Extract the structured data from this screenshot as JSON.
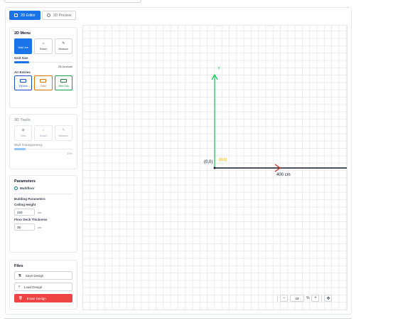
{
  "tabs": [
    {
      "label": "2D Editor",
      "icon": "square-icon",
      "active": true
    },
    {
      "label": "3D Preview",
      "icon": "cube-icon",
      "active": false
    }
  ],
  "menu2d": {
    "title": "2D Menu",
    "tools": [
      {
        "label": "Wall Line",
        "icon": "pencil-icon",
        "glyph": "",
        "active": true
      },
      {
        "label": "Eraser",
        "icon": "eraser-icon",
        "glyph": "⌂",
        "active": false
      },
      {
        "label": "Measure",
        "icon": "ruler-icon",
        "glyph": "✎",
        "active": false
      }
    ],
    "grid_size_label": "Grid Size",
    "grid_size_value": "25.0cm/cell",
    "grid_size_fraction": 0.25,
    "air_entries_label": "Air Entries",
    "air_entries": [
      {
        "label": "Window",
        "color": "#1d4ed8"
      },
      {
        "label": "Door",
        "color": "#d97706"
      },
      {
        "label": "Vent Grid",
        "color": "#16a34a"
      }
    ]
  },
  "tools3d": {
    "title": "3D Tools",
    "tools": [
      {
        "label": "View",
        "icon": "eye-icon",
        "glyph": "◉"
      },
      {
        "label": "Eraser",
        "icon": "eraser-icon",
        "glyph": "⌂"
      },
      {
        "label": "Measure",
        "icon": "ruler-icon",
        "glyph": "✎"
      }
    ],
    "transparency_label": "Wall Transparency",
    "transparency_value": "20%",
    "transparency_fraction": 0.2
  },
  "parameters": {
    "title": "Parameters",
    "multifloor_label": "Multifloor",
    "building_label": "Building Parameters",
    "ceiling_label": "Ceiling Height",
    "ceiling_value": "220",
    "ceiling_unit": "cm",
    "deck_label": "Floor Deck Thickness",
    "deck_value": "35",
    "deck_unit": "cm"
  },
  "files": {
    "title": "Files",
    "save_label": "Save Design",
    "load_label": "Load Design",
    "erase_label": "Erase Design"
  },
  "canvas": {
    "y_axis_label": "Y",
    "origin_label": "(0,0)",
    "origin_label2": "(0,0)",
    "x_measure_label": "400 cm",
    "x_axis_color": "#dc2626",
    "y_axis_color": "#22c55e"
  },
  "zoom": {
    "minus": "−",
    "value": "19",
    "percent": "%",
    "plus": "+",
    "reset_icon": "✥"
  }
}
